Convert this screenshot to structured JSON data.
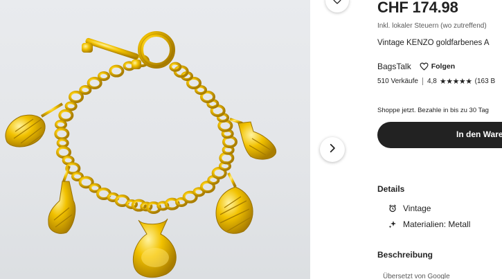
{
  "listing": {
    "price": "CHF 174.98",
    "tax_note": "Inkl. lokaler Steuern (wo zutreffend)",
    "title": "Vintage KENZO goldfarbenes A",
    "shop_name": "BagsTalk",
    "follow_label": "Folgen",
    "sales": "510 Verkäufe",
    "rating": "4,8",
    "stars": "★★★★★",
    "review_count": "(163 B",
    "shoppe_note": "Shoppe jetzt. Bezahle in bis zu 30 Tag",
    "cart_label": "In den Waren"
  },
  "details": {
    "heading": "Details",
    "items": [
      {
        "label": "Vintage",
        "icon": "alarm-clock-icon"
      },
      {
        "label": "Materialien: Metall",
        "icon": "sparkle-icon"
      }
    ]
  },
  "description": {
    "heading": "Beschreibung",
    "translated_note": "Übersetzt von Google"
  },
  "gallery": {
    "image_subject": "gold-chain-charm-bracelet",
    "accent_color": "#e6b800"
  }
}
